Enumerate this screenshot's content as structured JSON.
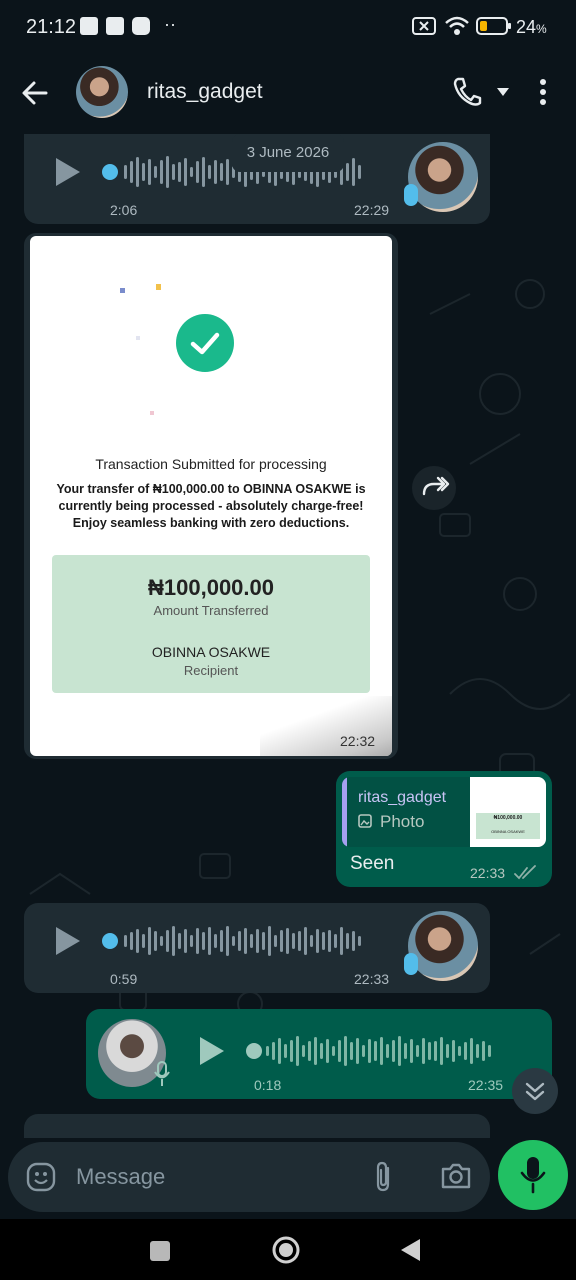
{
  "status_bar": {
    "time": "21:12",
    "battery": "24",
    "battery_unit": "%"
  },
  "header": {
    "contact_name": "ritas_gadget"
  },
  "date_chip": "3 June 2026",
  "messages": {
    "voice1": {
      "duration": "2:06",
      "time": "22:29"
    },
    "receipt": {
      "title": "Transaction Submitted for processing",
      "body": "Your transfer of ₦100,000.00 to OBINNA OSAKWE is currently being processed - absolutely charge-free! Enjoy seamless banking with zero deductions.",
      "amount": "₦100,000.00",
      "amount_label": "Amount Transferred",
      "recipient": "OBINNA OSAKWE",
      "recipient_label": "Recipient",
      "time": "22:32"
    },
    "reply": {
      "quoted_name": "ritas_gadget",
      "quoted_type": "Photo",
      "text": "Seen",
      "time": "22:33",
      "thumb_amount": "₦100,000.00",
      "thumb_recipient": "OBINNA OSAKWE"
    },
    "voice2": {
      "duration": "0:59",
      "time": "22:33"
    },
    "voice3": {
      "duration": "0:18",
      "time": "22:35"
    }
  },
  "composer": {
    "placeholder": "Message"
  },
  "colors": {
    "accent_green": "#21c063",
    "outgoing_bubble": "#005c4b",
    "incoming_bubble": "#1f2c33",
    "unplayed_dot": "#53bdeb"
  },
  "icons": [
    "back-arrow-icon",
    "phone-icon",
    "dropdown-icon",
    "more-vert-icon",
    "play-icon",
    "mic-icon",
    "forward-icon",
    "emoji-icon",
    "attach-icon",
    "camera-icon",
    "scroll-down-icon"
  ]
}
